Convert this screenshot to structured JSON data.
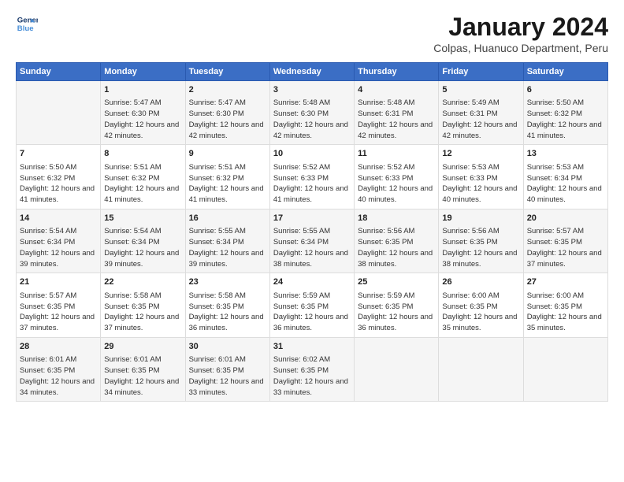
{
  "logo": {
    "line1": "General",
    "line2": "Blue"
  },
  "title": "January 2024",
  "location": "Colpas, Huanuco Department, Peru",
  "days_of_week": [
    "Sunday",
    "Monday",
    "Tuesday",
    "Wednesday",
    "Thursday",
    "Friday",
    "Saturday"
  ],
  "weeks": [
    [
      {
        "day": "",
        "info": ""
      },
      {
        "day": "1",
        "info": "Sunrise: 5:47 AM\nSunset: 6:30 PM\nDaylight: 12 hours\nand 42 minutes."
      },
      {
        "day": "2",
        "info": "Sunrise: 5:47 AM\nSunset: 6:30 PM\nDaylight: 12 hours\nand 42 minutes."
      },
      {
        "day": "3",
        "info": "Sunrise: 5:48 AM\nSunset: 6:30 PM\nDaylight: 12 hours\nand 42 minutes."
      },
      {
        "day": "4",
        "info": "Sunrise: 5:48 AM\nSunset: 6:31 PM\nDaylight: 12 hours\nand 42 minutes."
      },
      {
        "day": "5",
        "info": "Sunrise: 5:49 AM\nSunset: 6:31 PM\nDaylight: 12 hours\nand 42 minutes."
      },
      {
        "day": "6",
        "info": "Sunrise: 5:50 AM\nSunset: 6:32 PM\nDaylight: 12 hours\nand 41 minutes."
      }
    ],
    [
      {
        "day": "7",
        "info": "Sunrise: 5:50 AM\nSunset: 6:32 PM\nDaylight: 12 hours\nand 41 minutes."
      },
      {
        "day": "8",
        "info": "Sunrise: 5:51 AM\nSunset: 6:32 PM\nDaylight: 12 hours\nand 41 minutes."
      },
      {
        "day": "9",
        "info": "Sunrise: 5:51 AM\nSunset: 6:32 PM\nDaylight: 12 hours\nand 41 minutes."
      },
      {
        "day": "10",
        "info": "Sunrise: 5:52 AM\nSunset: 6:33 PM\nDaylight: 12 hours\nand 41 minutes."
      },
      {
        "day": "11",
        "info": "Sunrise: 5:52 AM\nSunset: 6:33 PM\nDaylight: 12 hours\nand 40 minutes."
      },
      {
        "day": "12",
        "info": "Sunrise: 5:53 AM\nSunset: 6:33 PM\nDaylight: 12 hours\nand 40 minutes."
      },
      {
        "day": "13",
        "info": "Sunrise: 5:53 AM\nSunset: 6:34 PM\nDaylight: 12 hours\nand 40 minutes."
      }
    ],
    [
      {
        "day": "14",
        "info": "Sunrise: 5:54 AM\nSunset: 6:34 PM\nDaylight: 12 hours\nand 39 minutes."
      },
      {
        "day": "15",
        "info": "Sunrise: 5:54 AM\nSunset: 6:34 PM\nDaylight: 12 hours\nand 39 minutes."
      },
      {
        "day": "16",
        "info": "Sunrise: 5:55 AM\nSunset: 6:34 PM\nDaylight: 12 hours\nand 39 minutes."
      },
      {
        "day": "17",
        "info": "Sunrise: 5:55 AM\nSunset: 6:34 PM\nDaylight: 12 hours\nand 38 minutes."
      },
      {
        "day": "18",
        "info": "Sunrise: 5:56 AM\nSunset: 6:35 PM\nDaylight: 12 hours\nand 38 minutes."
      },
      {
        "day": "19",
        "info": "Sunrise: 5:56 AM\nSunset: 6:35 PM\nDaylight: 12 hours\nand 38 minutes."
      },
      {
        "day": "20",
        "info": "Sunrise: 5:57 AM\nSunset: 6:35 PM\nDaylight: 12 hours\nand 37 minutes."
      }
    ],
    [
      {
        "day": "21",
        "info": "Sunrise: 5:57 AM\nSunset: 6:35 PM\nDaylight: 12 hours\nand 37 minutes."
      },
      {
        "day": "22",
        "info": "Sunrise: 5:58 AM\nSunset: 6:35 PM\nDaylight: 12 hours\nand 37 minutes."
      },
      {
        "day": "23",
        "info": "Sunrise: 5:58 AM\nSunset: 6:35 PM\nDaylight: 12 hours\nand 36 minutes."
      },
      {
        "day": "24",
        "info": "Sunrise: 5:59 AM\nSunset: 6:35 PM\nDaylight: 12 hours\nand 36 minutes."
      },
      {
        "day": "25",
        "info": "Sunrise: 5:59 AM\nSunset: 6:35 PM\nDaylight: 12 hours\nand 36 minutes."
      },
      {
        "day": "26",
        "info": "Sunrise: 6:00 AM\nSunset: 6:35 PM\nDaylight: 12 hours\nand 35 minutes."
      },
      {
        "day": "27",
        "info": "Sunrise: 6:00 AM\nSunset: 6:35 PM\nDaylight: 12 hours\nand 35 minutes."
      }
    ],
    [
      {
        "day": "28",
        "info": "Sunrise: 6:01 AM\nSunset: 6:35 PM\nDaylight: 12 hours\nand 34 minutes."
      },
      {
        "day": "29",
        "info": "Sunrise: 6:01 AM\nSunset: 6:35 PM\nDaylight: 12 hours\nand 34 minutes."
      },
      {
        "day": "30",
        "info": "Sunrise: 6:01 AM\nSunset: 6:35 PM\nDaylight: 12 hours\nand 33 minutes."
      },
      {
        "day": "31",
        "info": "Sunrise: 6:02 AM\nSunset: 6:35 PM\nDaylight: 12 hours\nand 33 minutes."
      },
      {
        "day": "",
        "info": ""
      },
      {
        "day": "",
        "info": ""
      },
      {
        "day": "",
        "info": ""
      }
    ]
  ]
}
